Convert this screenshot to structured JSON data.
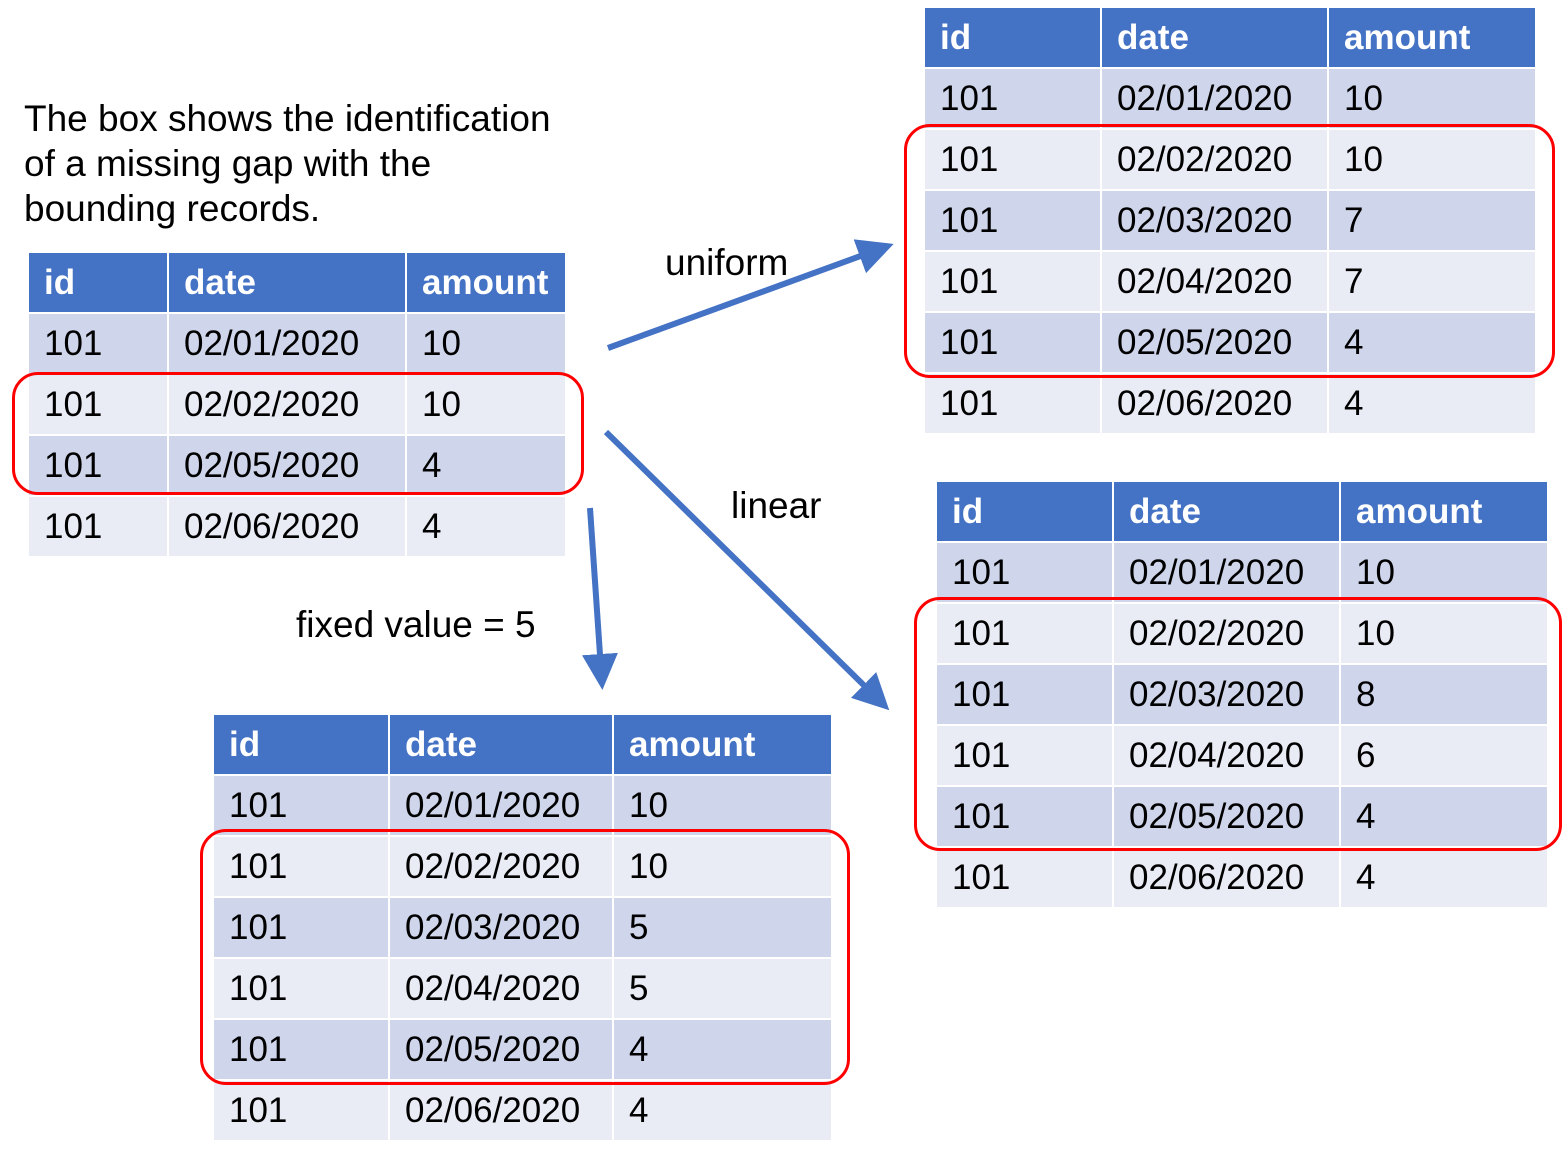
{
  "caption": "The box shows the identification\nof a missing gap with the\nbounding records.",
  "labels": {
    "uniform": "uniform",
    "linear": "linear",
    "fixed": "fixed value = 5"
  },
  "columns": [
    "id",
    "date",
    "amount"
  ],
  "tables": {
    "source": {
      "rows": [
        [
          "101",
          "02/01/2020",
          "10"
        ],
        [
          "101",
          "02/02/2020",
          "10"
        ],
        [
          "101",
          "02/05/2020",
          "4"
        ],
        [
          "101",
          "02/06/2020",
          "4"
        ]
      ],
      "boxed_rows": [
        1,
        2
      ]
    },
    "uniform": {
      "rows": [
        [
          "101",
          "02/01/2020",
          "10"
        ],
        [
          "101",
          "02/02/2020",
          "10"
        ],
        [
          "101",
          "02/03/2020",
          "7"
        ],
        [
          "101",
          "02/04/2020",
          "7"
        ],
        [
          "101",
          "02/05/2020",
          "4"
        ],
        [
          "101",
          "02/06/2020",
          "4"
        ]
      ],
      "boxed_rows": [
        1,
        2,
        3,
        4
      ]
    },
    "linear": {
      "rows": [
        [
          "101",
          "02/01/2020",
          "10"
        ],
        [
          "101",
          "02/02/2020",
          "10"
        ],
        [
          "101",
          "02/03/2020",
          "8"
        ],
        [
          "101",
          "02/04/2020",
          "6"
        ],
        [
          "101",
          "02/05/2020",
          "4"
        ],
        [
          "101",
          "02/06/2020",
          "4"
        ]
      ],
      "boxed_rows": [
        1,
        2,
        3,
        4
      ]
    },
    "fixed": {
      "rows": [
        [
          "101",
          "02/01/2020",
          "10"
        ],
        [
          "101",
          "02/02/2020",
          "10"
        ],
        [
          "101",
          "02/03/2020",
          "5"
        ],
        [
          "101",
          "02/04/2020",
          "5"
        ],
        [
          "101",
          "02/05/2020",
          "4"
        ],
        [
          "101",
          "02/06/2020",
          "4"
        ]
      ],
      "boxed_rows": [
        1,
        2,
        3,
        4
      ]
    }
  },
  "colors": {
    "header": "#4472c4",
    "row_dark": "#cfd5ea",
    "row_light": "#e9ebf5",
    "highlight_box": "#ff0000",
    "arrow": "#4472c4"
  }
}
